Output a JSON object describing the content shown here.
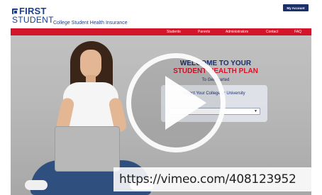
{
  "header": {
    "logo_top": "FIRST",
    "logo_bottom": "STUDENT",
    "site_title": "College Student Health Insurance",
    "account_button": "My Account"
  },
  "nav": {
    "items": [
      {
        "label": "Students"
      },
      {
        "label": "Parents"
      },
      {
        "label": "Administrators"
      },
      {
        "label": "Contact"
      },
      {
        "label": "FAQ"
      }
    ]
  },
  "hero": {
    "welcome_line1": "WELCOME TO YOUR",
    "welcome_line2": "STUDENT HEALTH PLAN",
    "get_started": "To Get Started",
    "select_label": "Select Your College or University",
    "select_value": ""
  },
  "video": {
    "play_icon": "play-icon",
    "url": "https://vimeo.com/408123952"
  },
  "colors": {
    "brand_blue": "#1b2f6b",
    "brand_red": "#d3152a"
  }
}
